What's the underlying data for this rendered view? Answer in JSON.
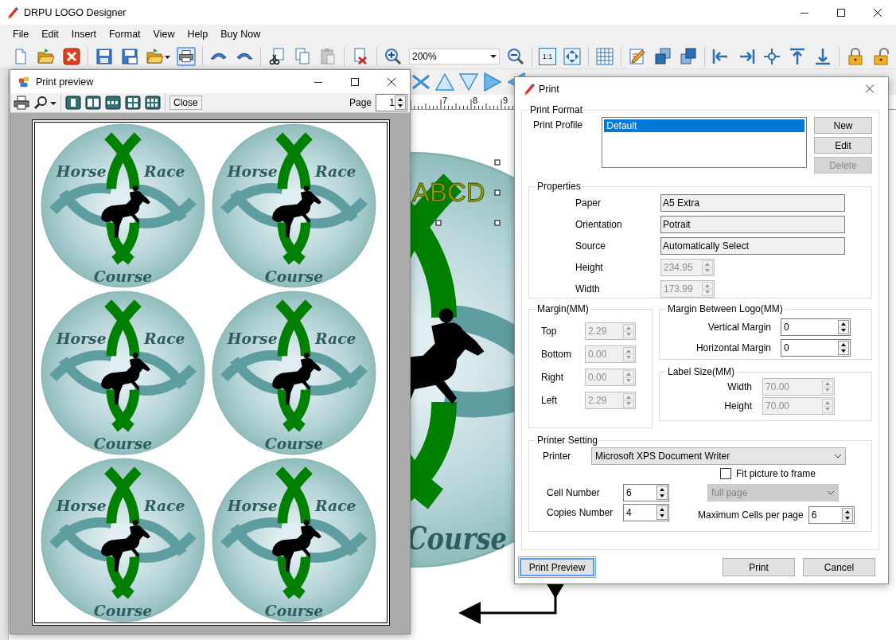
{
  "app": {
    "title": "DRPU LOGO Designer"
  },
  "menu": [
    "File",
    "Edit",
    "Insert",
    "Format",
    "View",
    "Help",
    "Buy Now"
  ],
  "toolbar": {
    "print_active": true,
    "zoom": "200%",
    "actual_size_label": "1:1"
  },
  "canvas": {
    "ruler_labels": [
      "7",
      "8",
      "9"
    ],
    "logo_texts": [
      "ABCD",
      "Course"
    ]
  },
  "preview": {
    "title": "Print preview",
    "close": "Close",
    "page_label": "Page",
    "page": "1",
    "logos": [
      {
        "texts": [
          "Horse",
          "Race",
          "Course"
        ]
      },
      {
        "texts": [
          "Horse",
          "Race",
          "Course"
        ]
      },
      {
        "texts": [
          "Horse",
          "Race",
          "Course"
        ]
      },
      {
        "texts": [
          "Horse",
          "Race",
          "Course"
        ]
      },
      {
        "texts": [
          "Horse",
          "Race",
          "Course"
        ]
      },
      {
        "texts": [
          "Horse",
          "Race",
          "Course"
        ]
      }
    ]
  },
  "print_dialog": {
    "title": "Print",
    "format_title": "Print Format",
    "profile_label": "Print Profile",
    "profiles": [
      {
        "name": "Default",
        "selected": true
      }
    ],
    "profile_buttons": [
      {
        "label": "New",
        "disabled": false
      },
      {
        "label": "Edit",
        "disabled": false
      },
      {
        "label": "Delete",
        "disabled": true
      }
    ],
    "properties": {
      "title": "Properties",
      "rows": [
        {
          "kind": "text",
          "label": "Paper",
          "value": "A5 Extra"
        },
        {
          "kind": "text",
          "label": "Orientation",
          "value": "Potrait"
        },
        {
          "kind": "text",
          "label": "Source",
          "value": "Automatically Select"
        },
        {
          "kind": "spin",
          "label": "Height",
          "value": "234.95",
          "disabled": true
        },
        {
          "kind": "spin",
          "label": "Width",
          "value": "173.99",
          "disabled": true
        }
      ]
    },
    "margin": {
      "title": "Margin(MM)",
      "rows": [
        {
          "label": "Top",
          "value": "2.29",
          "disabled": true
        },
        {
          "label": "Bottom",
          "value": "0.00",
          "disabled": true
        },
        {
          "label": "Right",
          "value": "0.00",
          "disabled": true
        },
        {
          "label": "Left",
          "value": "2.29",
          "disabled": true
        }
      ]
    },
    "logo_margin": {
      "title": "Margin Between Logo(MM)",
      "rows": [
        {
          "label": "Vertical Margin",
          "value": "0",
          "disabled": false
        },
        {
          "label": "Horizontal Margin",
          "value": "0",
          "disabled": false
        }
      ]
    },
    "label_size": {
      "title": "Label Size(MM)",
      "rows": [
        {
          "label": "Width",
          "value": "70.00",
          "disabled": true
        },
        {
          "label": "Height",
          "value": "70.00",
          "disabled": true
        }
      ]
    },
    "printer_setting": {
      "title": "Printer Setting",
      "printer_label": "Printer",
      "printer": "Microsoft XPS Document Writer",
      "cell_label": "Cell Number",
      "cell": "6",
      "copies_label": "Copies Number",
      "copies": "4",
      "fit_label": "Fit picture to frame",
      "fit_checked": false,
      "fit_mode": "full page",
      "fit_mode_disabled": true,
      "max_cells_label": "Maximum Cells per page",
      "max_cells": "6"
    },
    "buttons": [
      {
        "label": "Print Preview",
        "focused": true
      },
      {
        "label": "Print",
        "focused": false
      },
      {
        "label": "Cancel",
        "focused": false
      }
    ]
  }
}
